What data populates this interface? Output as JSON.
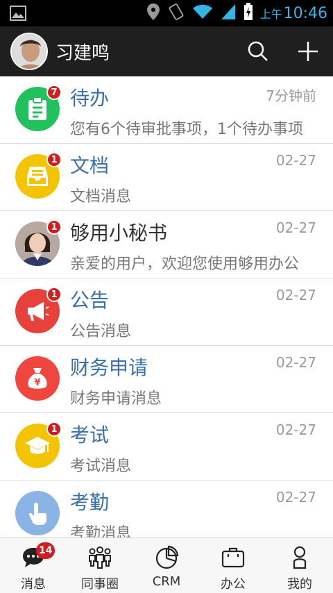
{
  "status_bar": {
    "time_prefix": "上午",
    "time": "10:46"
  },
  "header": {
    "title": "习建鸣"
  },
  "colors": {
    "accent_blue": "#3a6fa8",
    "badge_red": "#d01e1e",
    "todo_green": "#21c25e",
    "doc_yellow": "#f5c400",
    "notice_red": "#e8413c",
    "finance_red": "#ef4640",
    "exam_yellow": "#f5c400",
    "attend_blue": "#8ab3e6"
  },
  "messages": [
    {
      "title": "待办",
      "time": "7分钟前",
      "subtitle": "您有6个待审批事项，1个待办事项",
      "badge": "7",
      "icon": "clipboard-icon"
    },
    {
      "title": "文档",
      "time": "02-27",
      "subtitle": "文档消息",
      "badge": "1",
      "icon": "document-tray-icon"
    },
    {
      "title": "够用小秘书",
      "time": "02-27",
      "subtitle": "亲爱的用户，欢迎您使用够用办公",
      "badge": "1",
      "icon": "assistant-avatar"
    },
    {
      "title": "公告",
      "time": "02-27",
      "subtitle": "公告消息",
      "badge": "1",
      "icon": "megaphone-icon"
    },
    {
      "title": "财务申请",
      "time": "02-27",
      "subtitle": "财务申请消息",
      "badge": "",
      "icon": "money-bag-icon"
    },
    {
      "title": "考试",
      "time": "02-27",
      "subtitle": "考试消息",
      "badge": "1",
      "icon": "graduation-cap-icon"
    },
    {
      "title": "考勤",
      "time": "02-27",
      "subtitle": "考勤消息",
      "badge": "",
      "icon": "hand-tap-icon"
    }
  ],
  "tabs": [
    {
      "label": "消息",
      "badge": "14",
      "icon": "chat-bubble-icon"
    },
    {
      "label": "同事圈",
      "icon": "people-icon"
    },
    {
      "label": "CRM",
      "icon": "pie-chart-icon"
    },
    {
      "label": "办公",
      "icon": "briefcase-icon"
    },
    {
      "label": "我的",
      "icon": "person-icon"
    }
  ]
}
